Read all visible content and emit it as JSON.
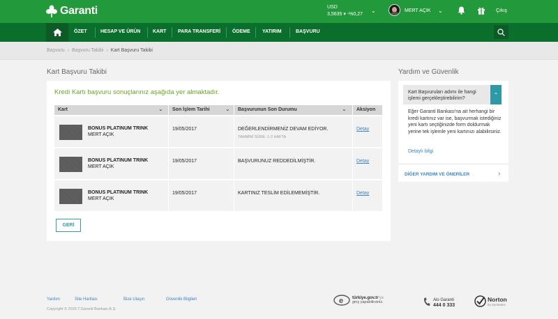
{
  "header": {
    "brand": "Garanti",
    "currency": {
      "code": "USD",
      "rate": "3,5635",
      "change": "▾ -%0,27"
    },
    "user_name": "MERT AÇIK",
    "logout": "Çıkış",
    "colors": {
      "header": "#22993b",
      "nav": "#0a6e2c",
      "accent": "#6aa52a",
      "link": "#3b83c3",
      "teal": "#2e9aa6"
    }
  },
  "nav": {
    "home_icon": "home-icon",
    "items": [
      "ÖZET",
      "HESAP VE ÜRÜN",
      "KART",
      "PARA TRANSFERİ",
      "ÖDEME",
      "YATIRIM",
      "BAŞVURU"
    ],
    "search_icon": "search-icon"
  },
  "breadcrumb": [
    "Başvuru",
    "Başvuru Takibi",
    "Kart Başvuru Takibi"
  ],
  "main": {
    "title": "Kart Başvuru Takibi",
    "headline": "Kredi Kartı başvuru sonuçlarınız aşağıda yer almaktadır.",
    "columns": [
      "Kart",
      "Son İşlem Tarihi",
      "Başvurunun Son Durumu",
      "Aksiyon"
    ],
    "rows": [
      {
        "card": "BONUS PLATINUM TRINK",
        "owner": "MERT AÇIK",
        "date": "19/05/2017",
        "status": "DEĞERLENDİRMENİZ DEVAM EDİYOR.",
        "note": "TAHMİNİ SÜRE: 1-2 HAFTA",
        "action": "Detay"
      },
      {
        "card": "BONUS PLATINUM TRINK",
        "owner": "MERT AÇIK",
        "date": "19/05/2017",
        "status": "BAŞVURUNUZ REDDEDİLMİŞTİR.",
        "note": "",
        "action": "Detay"
      },
      {
        "card": "BONUS PLATINUM TRINK",
        "owner": "MERT AÇIK",
        "date": "19/05/2017",
        "status": "KARTINIZ TESLİM EDİLEMEMİŞTİR.",
        "note": "",
        "action": "Detay"
      }
    ],
    "back_button": "GERİ"
  },
  "help": {
    "title": "Yardım ve Güvenlik",
    "question": "Kart Başvuruları adımı ile hangi işlemi gerçekleştirebilirim?",
    "answer": "Eğer Garanti Bankası'na ait herhangi bir kredi kartınız var ise, başvurmak istediğiniz yeni kartı seçtiğinizde form doldurmak yerine tek işlemle yeni kartınızı alabilirsiniz.",
    "link": "Detaylı bilgi",
    "more": "DİĞER YARDIM VE ÖNERİLER"
  },
  "footer": {
    "links": [
      "Yardım",
      "Site Haritası",
      "Bize Ulaşın",
      "Güvenlik Bilgileri"
    ],
    "copyright": "Copyright © 2015 T.Garanti Bankası A.Ş.",
    "egov_domain": "türkiye.gov.tr",
    "egov_suffix": "'ye",
    "egov_text": "giriş yapabilirsiniz.",
    "alo_label": "Alo Garanti",
    "alo_number": "444 0 333",
    "norton": "Norton",
    "norton_sub": "by Symantec"
  }
}
